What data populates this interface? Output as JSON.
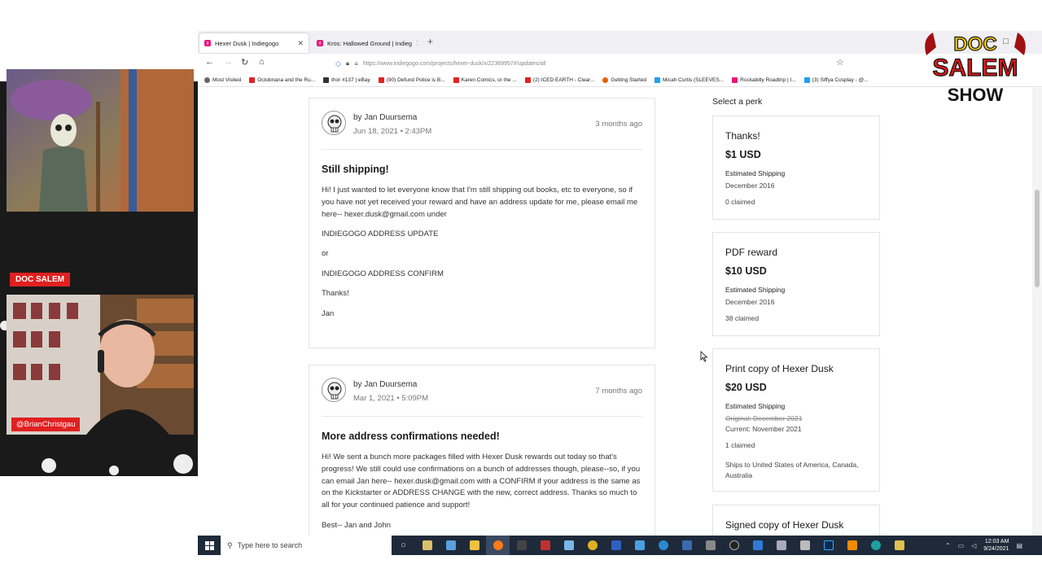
{
  "browser": {
    "tabs": [
      {
        "label": "Hexer Dusk | Indiegogo",
        "favicon": "indiegogo-icon"
      },
      {
        "label": "Kros: Hallowed Ground | Indieg",
        "favicon": "indiegogo-icon"
      }
    ],
    "url": "https://www.indiegogo.com/projects/hexer-dusk/x/22369957#/updates/all",
    "bookmarks": [
      {
        "label": "Most Visited",
        "color": "#666666"
      },
      {
        "label": "Octobnana and the Ru...",
        "color": "#e22222"
      },
      {
        "label": "thor #137 | eBay",
        "color": "#333333"
      },
      {
        "label": "(90) Defund Police is B...",
        "color": "#e22222"
      },
      {
        "label": "Karen Comics, or the ...",
        "color": "#e22222"
      },
      {
        "label": "(2) ICED EARTH - Clear...",
        "color": "#e22222"
      },
      {
        "label": "Getting Started",
        "color": "#e66000"
      },
      {
        "label": "Micah Curtis (SLEEVES...",
        "color": "#1da1f2"
      },
      {
        "label": "Rockabilly Roadtrip | I...",
        "color": "#eb1478"
      },
      {
        "label": "(3) Siffya Cosplay - @...",
        "color": "#1da1f2"
      }
    ]
  },
  "updates": [
    {
      "author": "by Jan Duursema",
      "date": "Jun 18, 2021 • 2:43PM",
      "ago": "3 months ago",
      "title": "Still shipping!",
      "paragraphs": [
        "Hi! I just wanted to let everyone know that I'm still shipping out books, etc to everyone, so if you have not yet received your reward and have an address update for me, please email me here-- hexer.dusk@gmail.com under",
        "INDIEGOGO ADDRESS UPDATE",
        "or",
        "INDIEGOGO ADDRESS CONFIRM",
        "Thanks!",
        "Jan"
      ]
    },
    {
      "author": "by Jan Duursema",
      "date": "Mar 1, 2021 • 5:09PM",
      "ago": "7 months ago",
      "title": "More address confirmations needed!",
      "paragraphs": [
        "Hi! We sent a bunch more packages filled with Hexer Dusk rewards out today so that's progress! We still could use confirmations on a bunch of addresses though, please--so, if you can email Jan here-- hexer.dusk@gmail.com with a CONFIRM if your address is the same as on the Kickstarter or ADDRESS CHANGE with the new, correct address. Thanks so much to all for your continued patience and support!",
        "Best-- Jan and John"
      ]
    }
  ],
  "perks": {
    "heading": "Select a perk",
    "items": [
      {
        "title": "Thanks!",
        "price": "$1 USD",
        "ship_label": "Estimated Shipping",
        "ship": "December 2016",
        "claimed": "0 claimed"
      },
      {
        "title": "PDF reward",
        "price": "$10 USD",
        "ship_label": "Estimated Shipping",
        "ship": "December 2016",
        "claimed": "38 claimed"
      },
      {
        "title": "Print copy of Hexer Dusk",
        "price": "$20 USD",
        "ship_label": "Estimated Shipping",
        "original": "Original: December 2021",
        "current": "Current: November 2021",
        "claimed": "1 claimed",
        "ships_to": "Ships to United States of America, Canada, Australia"
      },
      {
        "title": "Signed copy of Hexer Dusk"
      }
    ]
  },
  "taskbar": {
    "search_placeholder": "Type here to search",
    "time": "12:03 AM",
    "date": "9/24/2021"
  },
  "overlay": {
    "name_badge": "DOC SALEM",
    "handle": "@BrianChristgau",
    "logo_line1": "DOC",
    "logo_line2": "SALEM",
    "logo_line3": "SHOW"
  }
}
